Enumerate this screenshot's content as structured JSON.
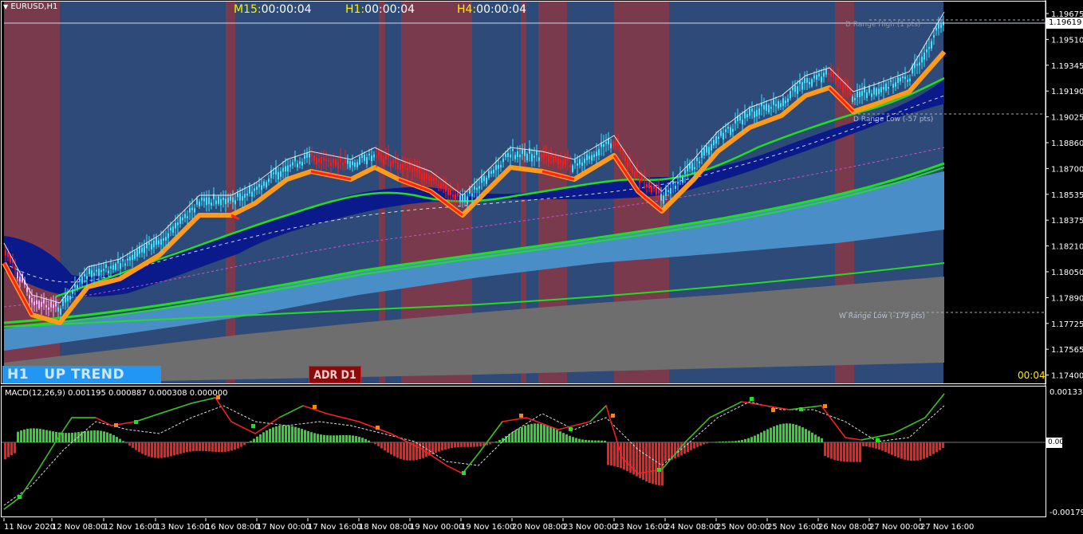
{
  "symbol": "EURUSD,H1",
  "timers": [
    {
      "tf": "M15:",
      "value": "00:00:04"
    },
    {
      "tf": "H1:",
      "value": "00:00:04"
    },
    {
      "tf": "H4:",
      "value": "00:00:04"
    }
  ],
  "current_price": "1.19619",
  "price_axis": [
    "1.19675",
    "1.19510",
    "1.19345",
    "1.19190",
    "1.19025",
    "1.18860",
    "1.18700",
    "1.18535",
    "1.18375",
    "1.18210",
    "1.18050",
    "1.17890",
    "1.17725",
    "1.17565",
    "1.17400"
  ],
  "range_labels": {
    "high": "D Range High (1 pts)",
    "low_d": "D Range Low (-57 pts)",
    "low_w": "W Range Low (-179 pts)"
  },
  "trend_badge": "H1   UP TREND",
  "adr_badge": "ADR D1",
  "countdown": "00:04",
  "macd": {
    "label": "MACD(12,26,9) 0.001195 0.000887 0.000308 0.000000",
    "axis": [
      "0.001337",
      "0.00",
      "-0.001798"
    ]
  },
  "time_axis": [
    "11 Nov 2020",
    "12 Nov 08:00",
    "12 Nov 16:00",
    "13 Nov 16:00",
    "16 Nov 08:00",
    "17 Nov 00:00",
    "17 Nov 16:00",
    "18 Nov 08:00",
    "19 Nov 00:00",
    "19 Nov 16:00",
    "20 Nov 08:00",
    "23 Nov 00:00",
    "23 Nov 16:00",
    "24 Nov 08:00",
    "25 Nov 00:00",
    "25 Nov 16:00",
    "26 Nov 08:00",
    "27 Nov 00:00",
    "27 Nov 16:00"
  ],
  "colors": {
    "up_zone": "#2d4a78",
    "down_zone": "#7a3a4e",
    "light_band": "#4a8ec8",
    "gray_band": "#6e6e6e",
    "dark_band": "#0a1a8a",
    "green_ma": "#22dd22",
    "orange": "#ff9a1a"
  }
}
